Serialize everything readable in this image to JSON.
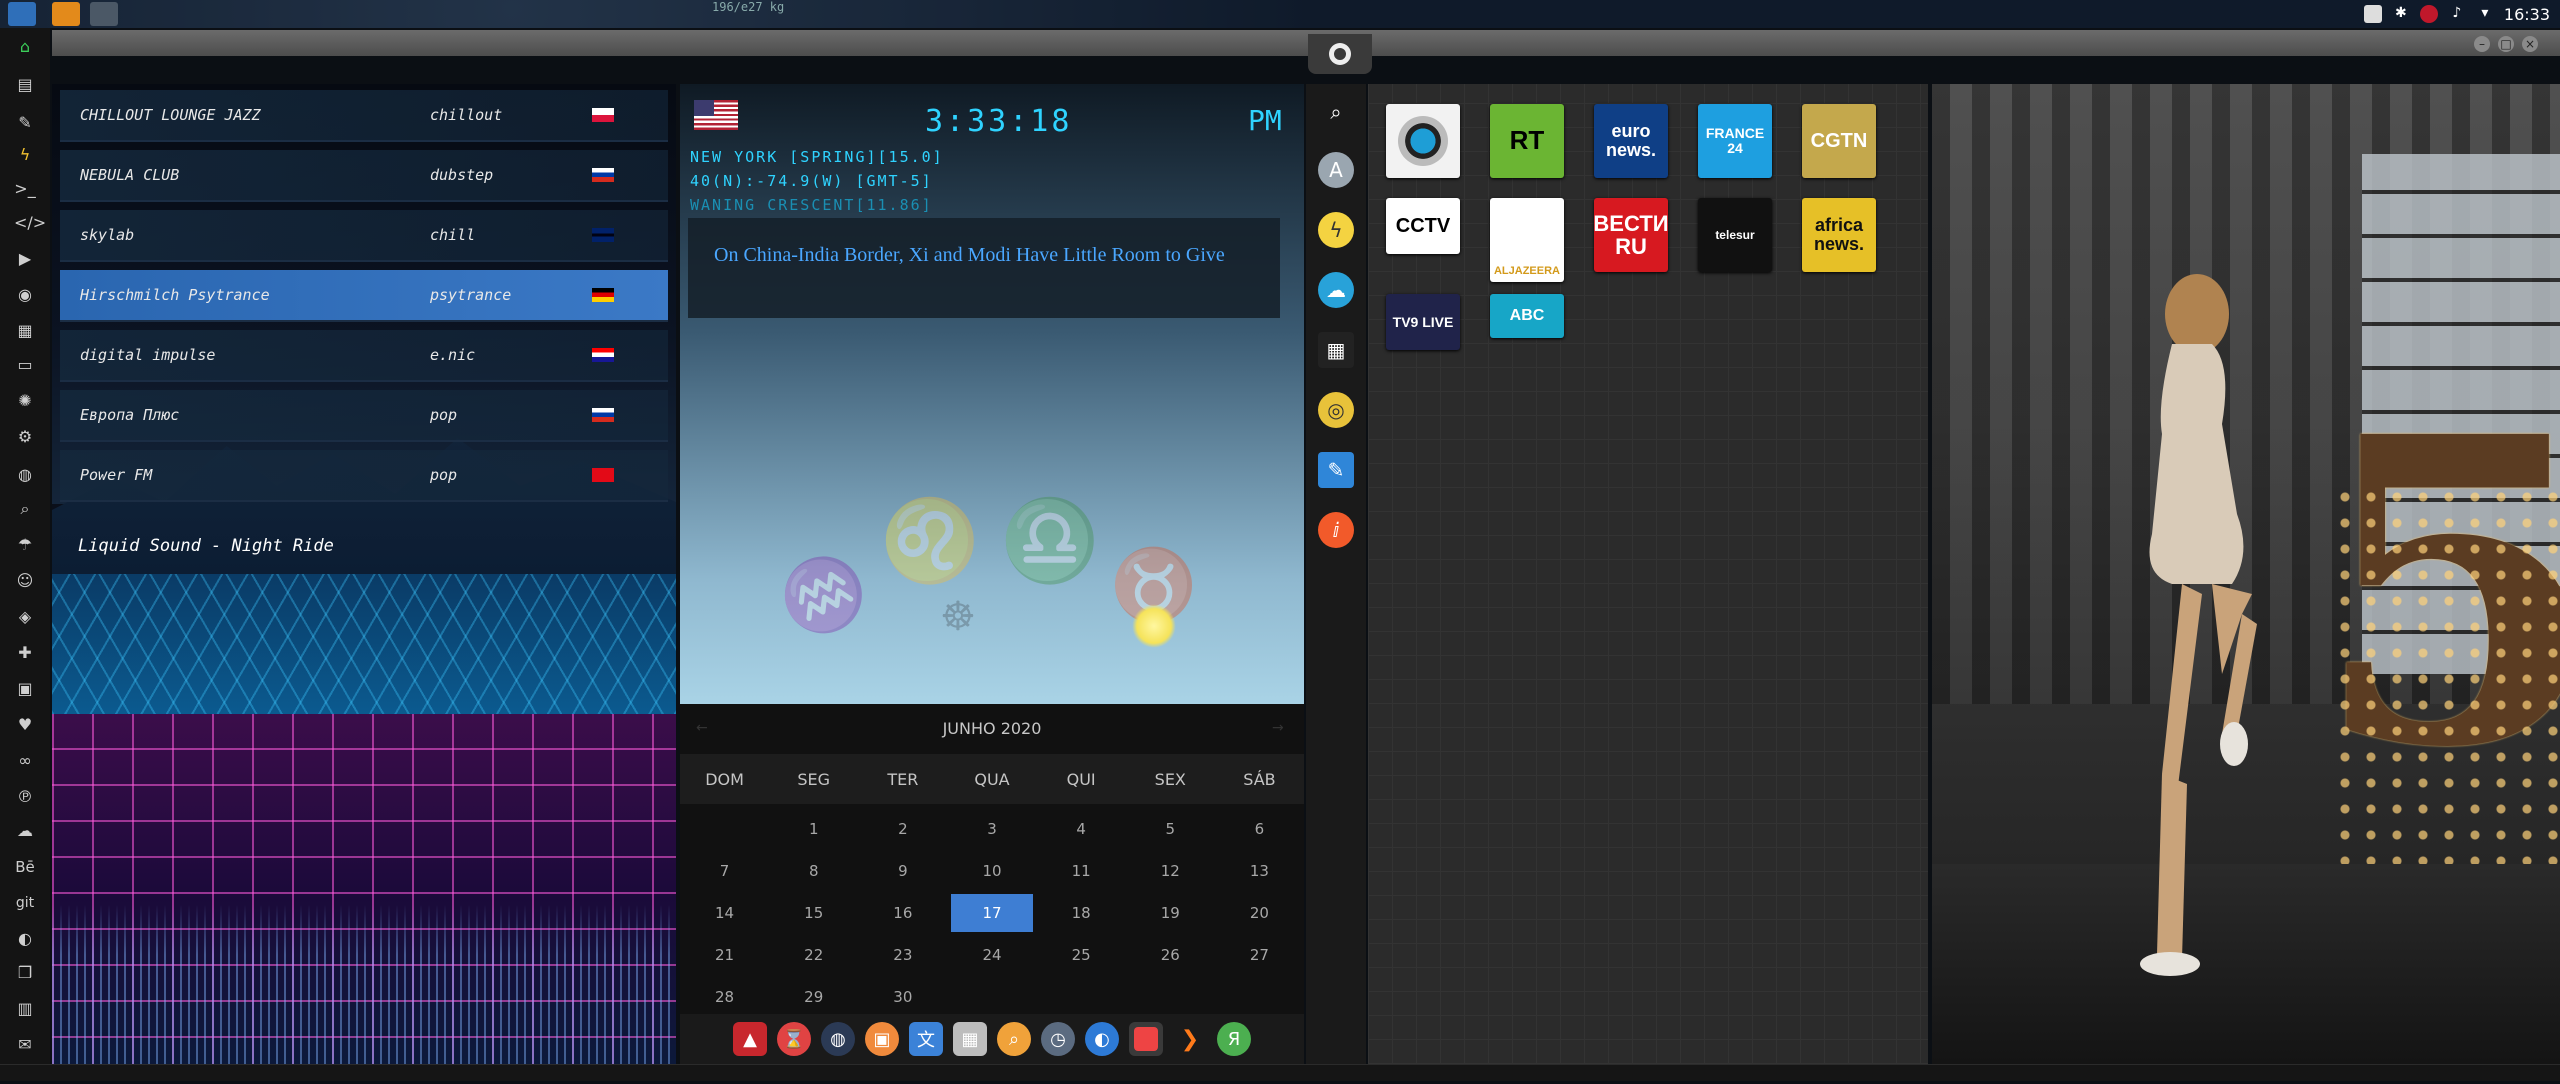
{
  "top_bar": {
    "mini_label": "196/e27 kg",
    "tray_icons": [
      "photo-icon",
      "bluetooth-icon",
      "bug-icon",
      "volume-icon",
      "wifi-icon"
    ],
    "clock": "16:33"
  },
  "window": {
    "controls": [
      "minimize",
      "maximize",
      "close"
    ],
    "emblem": "rebel-alliance-icon"
  },
  "dock": {
    "icons": [
      "home-icon",
      "document-icon",
      "edit-icon",
      "lightning-icon",
      "terminal-icon",
      "code-icon",
      "play-icon",
      "music-icon",
      "image-icon",
      "id-card-icon",
      "atom-icon",
      "gear-icon",
      "globe-icon",
      "search-icon",
      "umbrella-icon",
      "contact-icon",
      "tag-icon",
      "tools-icon",
      "youtube-icon",
      "heart-icon",
      "lastfm-icon",
      "pinterest-icon",
      "cloud-icon",
      "behance-icon",
      "git-icon",
      "github-icon",
      "cubes-icon",
      "map-icon",
      "mail-icon",
      "list-icon"
    ],
    "labels": {
      "behance": "Bē",
      "git": "git"
    }
  },
  "radio": {
    "stations": [
      {
        "name": "CHILLOUT LOUNGE JAZZ",
        "genre": "chillout",
        "flag": "poland"
      },
      {
        "name": "NEBULA CLUB",
        "genre": "dubstep",
        "flag": "russia"
      },
      {
        "name": "skylab",
        "genre": "chill",
        "flag": "uk"
      },
      {
        "name": "Hirschmilch Psytrance",
        "genre": "psytrance",
        "flag": "germany"
      },
      {
        "name": "digital impulse",
        "genre": "e.nic",
        "flag": "croatia"
      },
      {
        "name": "Европа Плюс",
        "genre": "pop",
        "flag": "russia"
      },
      {
        "name": "Power FM",
        "genre": "pop",
        "flag": "turkey"
      }
    ],
    "selected_index": 3,
    "now_playing": "Liquid Sound - Night Ride"
  },
  "weather": {
    "time": "3:33:18",
    "ampm": "PM",
    "line1": "NEW YORK [SPRING][15.0]",
    "line2": "40(N):-74.9(W) [GMT-5]",
    "line3": "WANING CRESCENT[11.86]",
    "headline": "On China-India Border, Xi and Modi Have Little Room to Give"
  },
  "calendar": {
    "month": "JUNHO 2020",
    "prev": "←",
    "next": "→",
    "weekdays": [
      "DOM",
      "SEG",
      "TER",
      "QUA",
      "QUI",
      "SEX",
      "SÁB"
    ],
    "leading_blanks": 1,
    "days": [
      "1",
      "2",
      "3",
      "4",
      "5",
      "6",
      "7",
      "8",
      "9",
      "10",
      "11",
      "12",
      "13",
      "14",
      "15",
      "16",
      "17",
      "18",
      "19",
      "20",
      "21",
      "22",
      "23",
      "24",
      "25",
      "26",
      "27",
      "28",
      "29",
      "30"
    ],
    "today": "17"
  },
  "taskbar": {
    "apps": [
      "anydesk-icon",
      "hourglass-icon",
      "globe-dark-icon",
      "photos-icon",
      "translate-icon",
      "calendar-app-icon",
      "search-app-icon",
      "clock-icon",
      "browser-icon",
      "calendar-active-icon",
      "play-arrow-icon",
      "yandex-icon"
    ],
    "active_index": 9
  },
  "launcher": {
    "icons": [
      "search-icon",
      "astrology-icon",
      "pikachu-icon",
      "cloud-upload-icon",
      "clapperboard-icon",
      "gold-disc-icon",
      "edit-blue-icon",
      "food-icon"
    ]
  },
  "news_tiles": [
    {
      "name": "circle-news",
      "label": "",
      "bg": "#f2f2f2",
      "fg": "#111"
    },
    {
      "name": "rt",
      "label": "RT",
      "bg": "#6bb533",
      "fg": "#000"
    },
    {
      "name": "euronews",
      "label": "euro news.",
      "bg": "#0f3f86",
      "fg": "#fff"
    },
    {
      "name": "france24",
      "label": "FRANCE 24",
      "bg": "#1e9fe0",
      "fg": "#fff"
    },
    {
      "name": "cgtn",
      "label": "CGTN",
      "bg": "#c4a84c",
      "fg": "#fff"
    },
    {
      "name": "cctv",
      "label": "CCTV",
      "bg": "#ffffff",
      "fg": "#000"
    },
    {
      "name": "aljazeera",
      "label": "ALJAZEERA",
      "bg": "#ffffff",
      "fg": "#d39a1b"
    },
    {
      "name": "vesti-ru",
      "label": "ВЕСТИ RU",
      "bg": "#d71920",
      "fg": "#fff"
    },
    {
      "name": "telesur",
      "label": "telesur",
      "bg": "#111111",
      "fg": "#fff"
    },
    {
      "name": "africanews",
      "label": "africa news.",
      "bg": "#e6c027",
      "fg": "#111"
    },
    {
      "name": "tv9",
      "label": "TV9 LIVE",
      "bg": "#20234a",
      "fg": "#fff"
    },
    {
      "name": "abc",
      "label": "ABC",
      "bg": "#17a6c7",
      "fg": "#fff"
    }
  ]
}
